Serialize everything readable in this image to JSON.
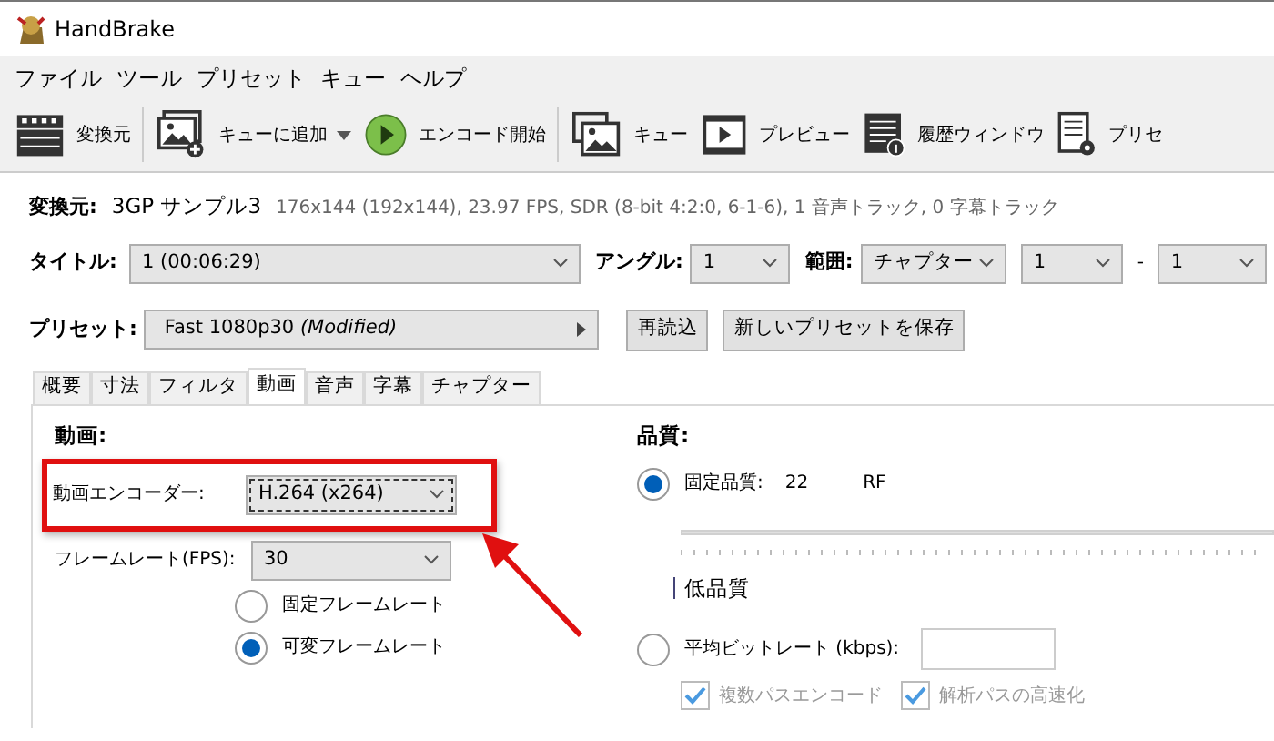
{
  "window": {
    "title": "HandBrake"
  },
  "menu": [
    "ファイル",
    "ツール",
    "プリセット",
    "キュー",
    "ヘルプ"
  ],
  "toolbar": [
    {
      "kind": "source",
      "label": "変換元",
      "dropdown": false,
      "separator_after": true
    },
    {
      "kind": "add_queue",
      "label": "キューに追加",
      "dropdown": true,
      "separator_after": false
    },
    {
      "kind": "start",
      "label": "エンコード開始",
      "dropdown": false,
      "separator_after": true
    },
    {
      "kind": "queue",
      "label": "キュー",
      "dropdown": false,
      "separator_after": false
    },
    {
      "kind": "preview",
      "label": "プレビュー",
      "dropdown": false,
      "separator_after": false
    },
    {
      "kind": "log",
      "label": "履歴ウィンドウ",
      "dropdown": false,
      "separator_after": false
    },
    {
      "kind": "presets",
      "label": "プリセ",
      "dropdown": false,
      "separator_after": false
    }
  ],
  "source": {
    "label": "変換元:",
    "name": "3GP サンプル3",
    "info": "176x144 (192x144), 23.97 FPS, SDR (8-bit 4:2:0, 6-1-6), 1 音声トラック, 0 字幕トラック"
  },
  "title_select": {
    "label": "タイトル:",
    "value": "1  (00:06:29)"
  },
  "angle": {
    "label": "アングル:",
    "value": "1"
  },
  "range": {
    "label": "範囲:",
    "mode": "チャプター",
    "start": "1",
    "separator": "-",
    "end": "1"
  },
  "preset": {
    "label": "プリセット:",
    "value": "Fast 1080p30  *(Modified)*",
    "buttons": [
      "再読込",
      "新しいプリセットを保存"
    ]
  },
  "tabs": [
    {
      "label": "概要",
      "selected": false
    },
    {
      "label": "寸法",
      "selected": false
    },
    {
      "label": "フィルタ",
      "selected": false
    },
    {
      "label": "動画",
      "selected": true
    },
    {
      "label": "音声",
      "selected": false
    },
    {
      "label": "字幕",
      "selected": false
    },
    {
      "label": "チャプター",
      "selected": false
    }
  ],
  "video": {
    "heading": "動画:",
    "encoder": {
      "label": "動画エンコーダー:",
      "value": "H.264 (x264)",
      "focused": true
    },
    "framerate": {
      "label": "フレームレート(FPS):",
      "value": "30"
    },
    "framerate_modes": [
      {
        "label": "固定フレームレート",
        "selected": false
      },
      {
        "label": "可変フレームレート",
        "selected": true
      }
    ]
  },
  "quality": {
    "heading": "品質:",
    "constant": {
      "label": "固定品質:",
      "value": "22",
      "unit": "RF",
      "selected": true
    },
    "slider_label": "低品質",
    "bitrate": {
      "label": "平均ビットレート (kbps):",
      "selected": false
    },
    "options": [
      {
        "label": "複数パスエンコード",
        "checked": true,
        "disabled": true
      },
      {
        "label": "解析パスの高速化",
        "checked": true,
        "disabled": true
      }
    ]
  }
}
